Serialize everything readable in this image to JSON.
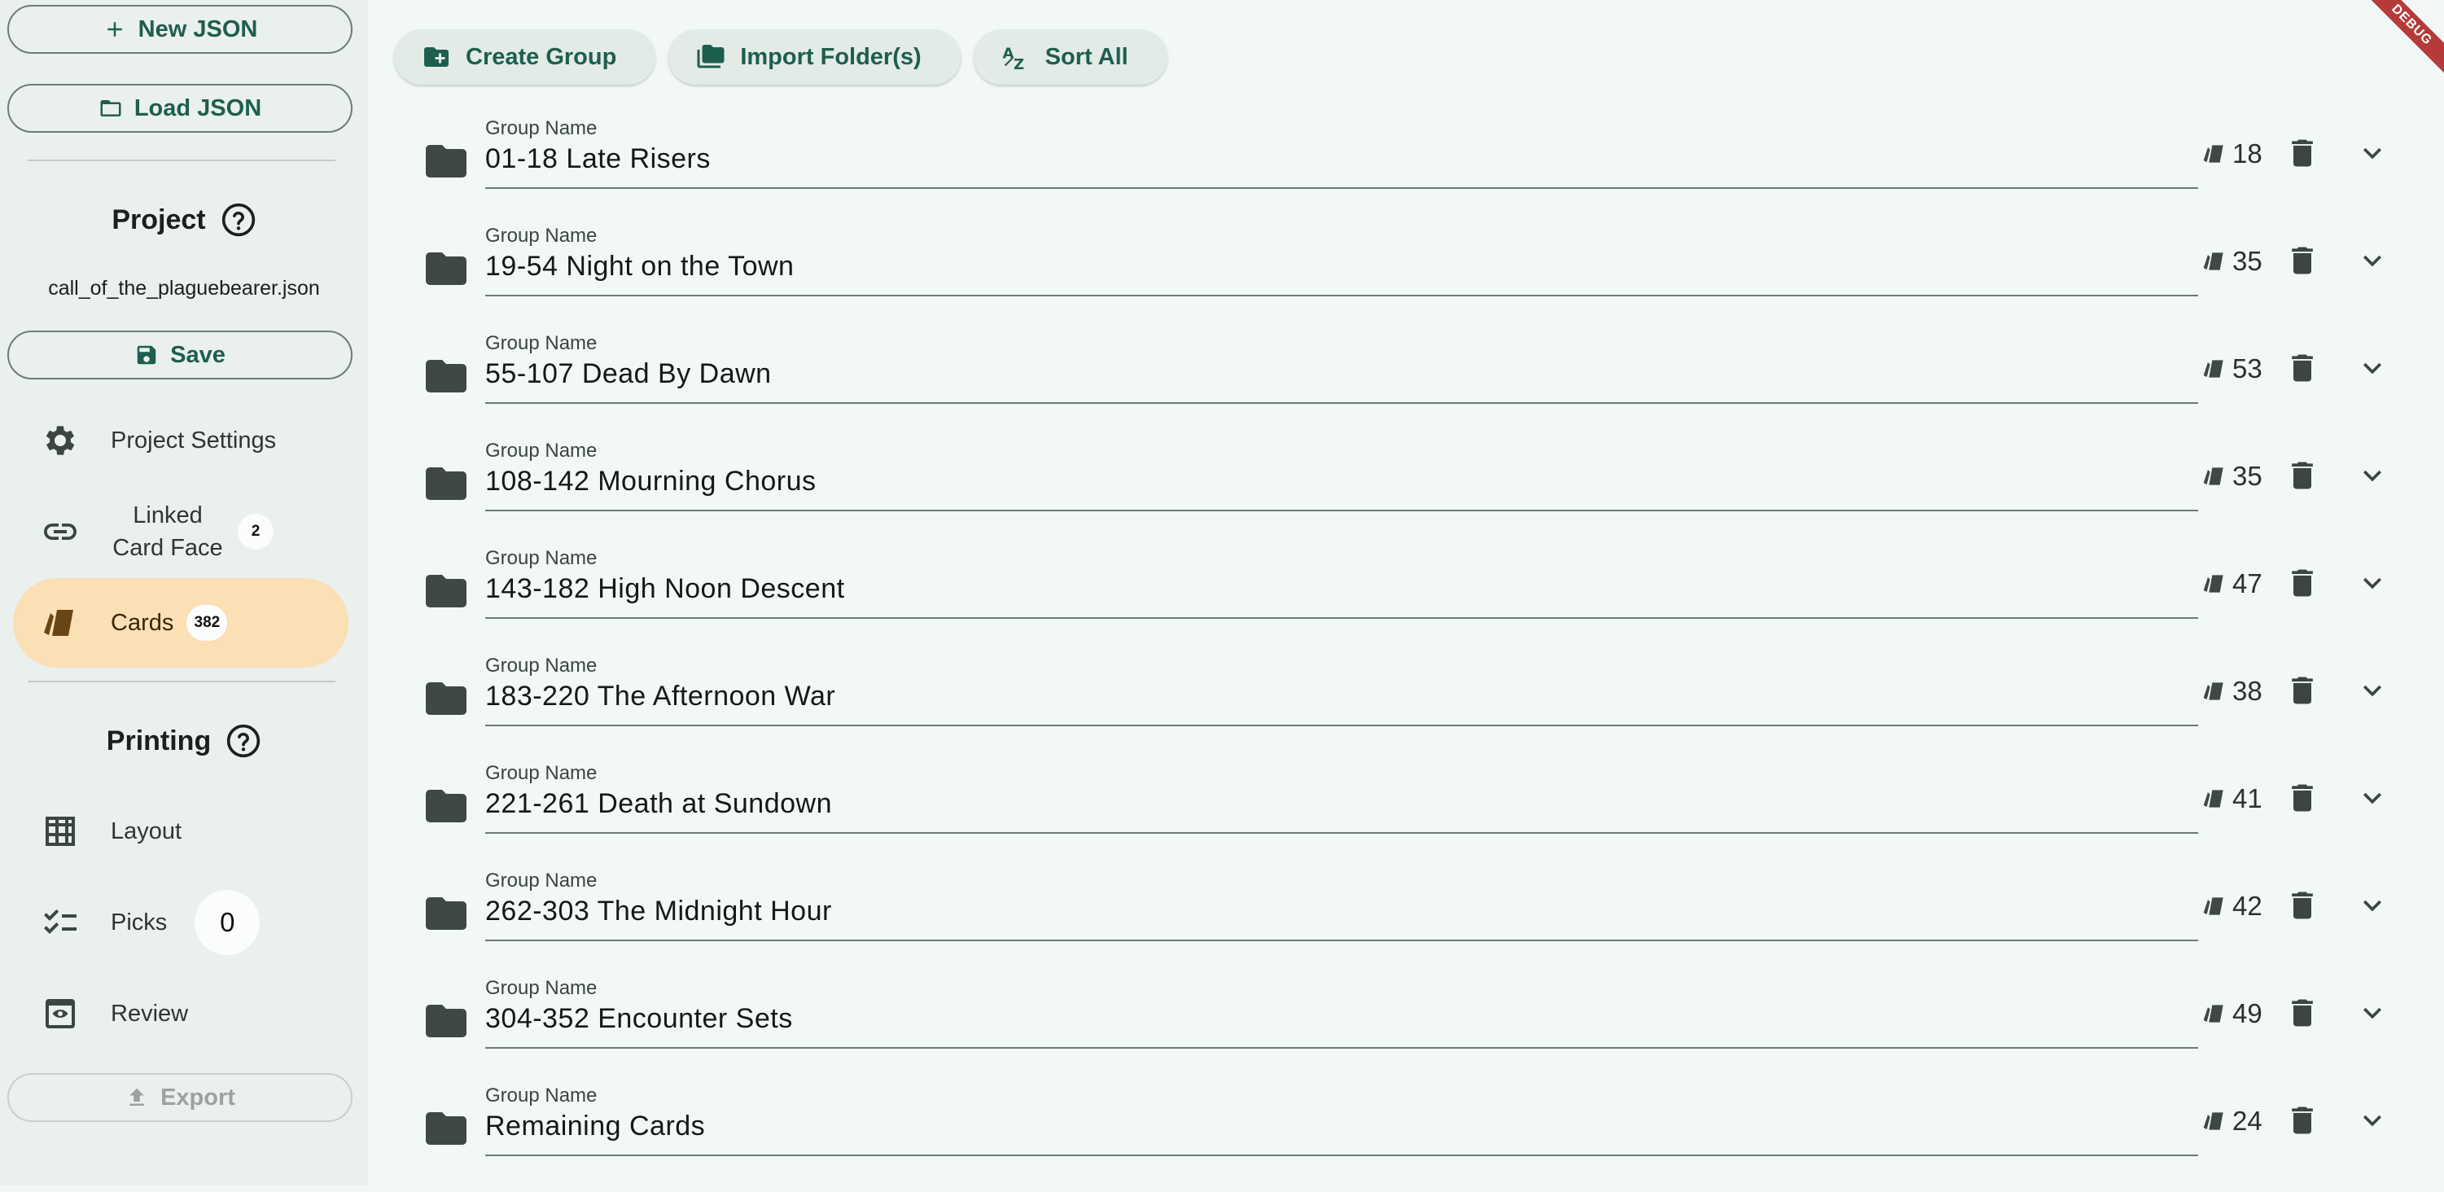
{
  "sidebar": {
    "new_json": "New JSON",
    "load_json": "Load JSON",
    "project_title": "Project",
    "project_file": "call_of_the_plaguebearer.json",
    "save": "Save",
    "nav": [
      {
        "label": "Project Settings",
        "icon": "gear-icon"
      },
      {
        "label": "Linked Card Face",
        "badge": "2",
        "icon": "link-icon"
      },
      {
        "label": "Cards",
        "badge": "382",
        "icon": "cards-icon",
        "active": true
      }
    ],
    "printing_title": "Printing",
    "printing_nav": [
      {
        "label": "Layout",
        "icon": "grid-icon"
      },
      {
        "label": "Picks",
        "badge": "0",
        "icon": "checklist-icon"
      },
      {
        "label": "Review",
        "icon": "preview-icon"
      }
    ],
    "export": "Export",
    "active_color": "#fbdfb5"
  },
  "toolbar": {
    "create_group": "Create Group",
    "import_folders": "Import Folder(s)",
    "sort_all": "Sort All"
  },
  "group_field_label": "Group Name",
  "groups": [
    {
      "name": "01-18 Late Risers",
      "count": "18"
    },
    {
      "name": "19-54 Night on the Town",
      "count": "35"
    },
    {
      "name": "55-107 Dead By Dawn",
      "count": "53"
    },
    {
      "name": "108-142 Mourning Chorus",
      "count": "35"
    },
    {
      "name": "143-182 High Noon Descent",
      "count": "47"
    },
    {
      "name": "183-220 The Afternoon War",
      "count": "38"
    },
    {
      "name": "221-261 Death at Sundown",
      "count": "41"
    },
    {
      "name": "262-303 The Midnight Hour",
      "count": "42"
    },
    {
      "name": "304-352 Encounter Sets",
      "count": "49"
    },
    {
      "name": "Remaining Cards",
      "count": "24"
    }
  ],
  "debug_banner": "DEBUG"
}
